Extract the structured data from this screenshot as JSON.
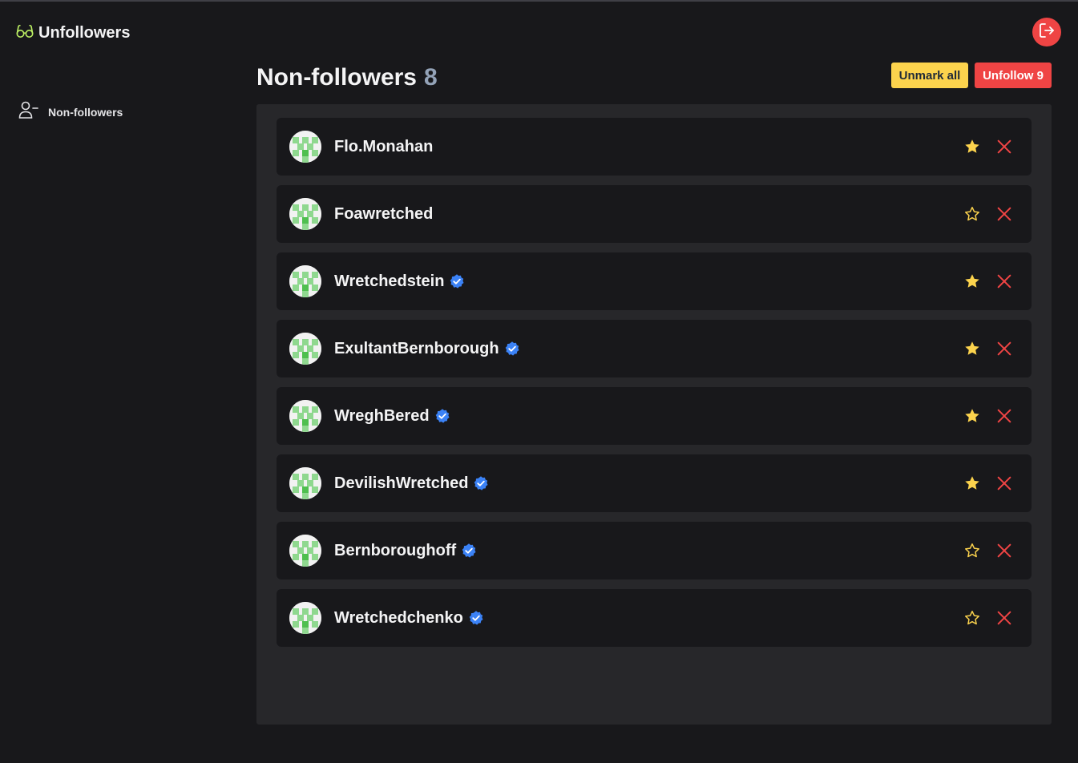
{
  "app": {
    "title": "Unfollowers",
    "accent_color": "#bef264",
    "logout_icon": "logout-icon"
  },
  "sidebar": {
    "items": [
      {
        "label": "Non-followers",
        "icon": "user-minus-icon"
      }
    ]
  },
  "header": {
    "title": "Non-followers",
    "count": "8",
    "unmark_label": "Unmark all",
    "unfollow_label": "Unfollow 9"
  },
  "colors": {
    "star": "#fcd34d",
    "remove": "#ef4444",
    "verified": "#3b82f6"
  },
  "users": [
    {
      "username": "Flo.Monahan",
      "verified": false,
      "starred": true
    },
    {
      "username": "Foawretched",
      "verified": false,
      "starred": false
    },
    {
      "username": "Wretchedstein",
      "verified": true,
      "starred": true
    },
    {
      "username": "ExultantBernborough",
      "verified": true,
      "starred": true
    },
    {
      "username": "WreghBered",
      "verified": true,
      "starred": true
    },
    {
      "username": "DevilishWretched",
      "verified": true,
      "starred": true
    },
    {
      "username": "Bernboroughoff",
      "verified": true,
      "starred": false
    },
    {
      "username": "Wretchedchenko",
      "verified": true,
      "starred": false
    }
  ]
}
